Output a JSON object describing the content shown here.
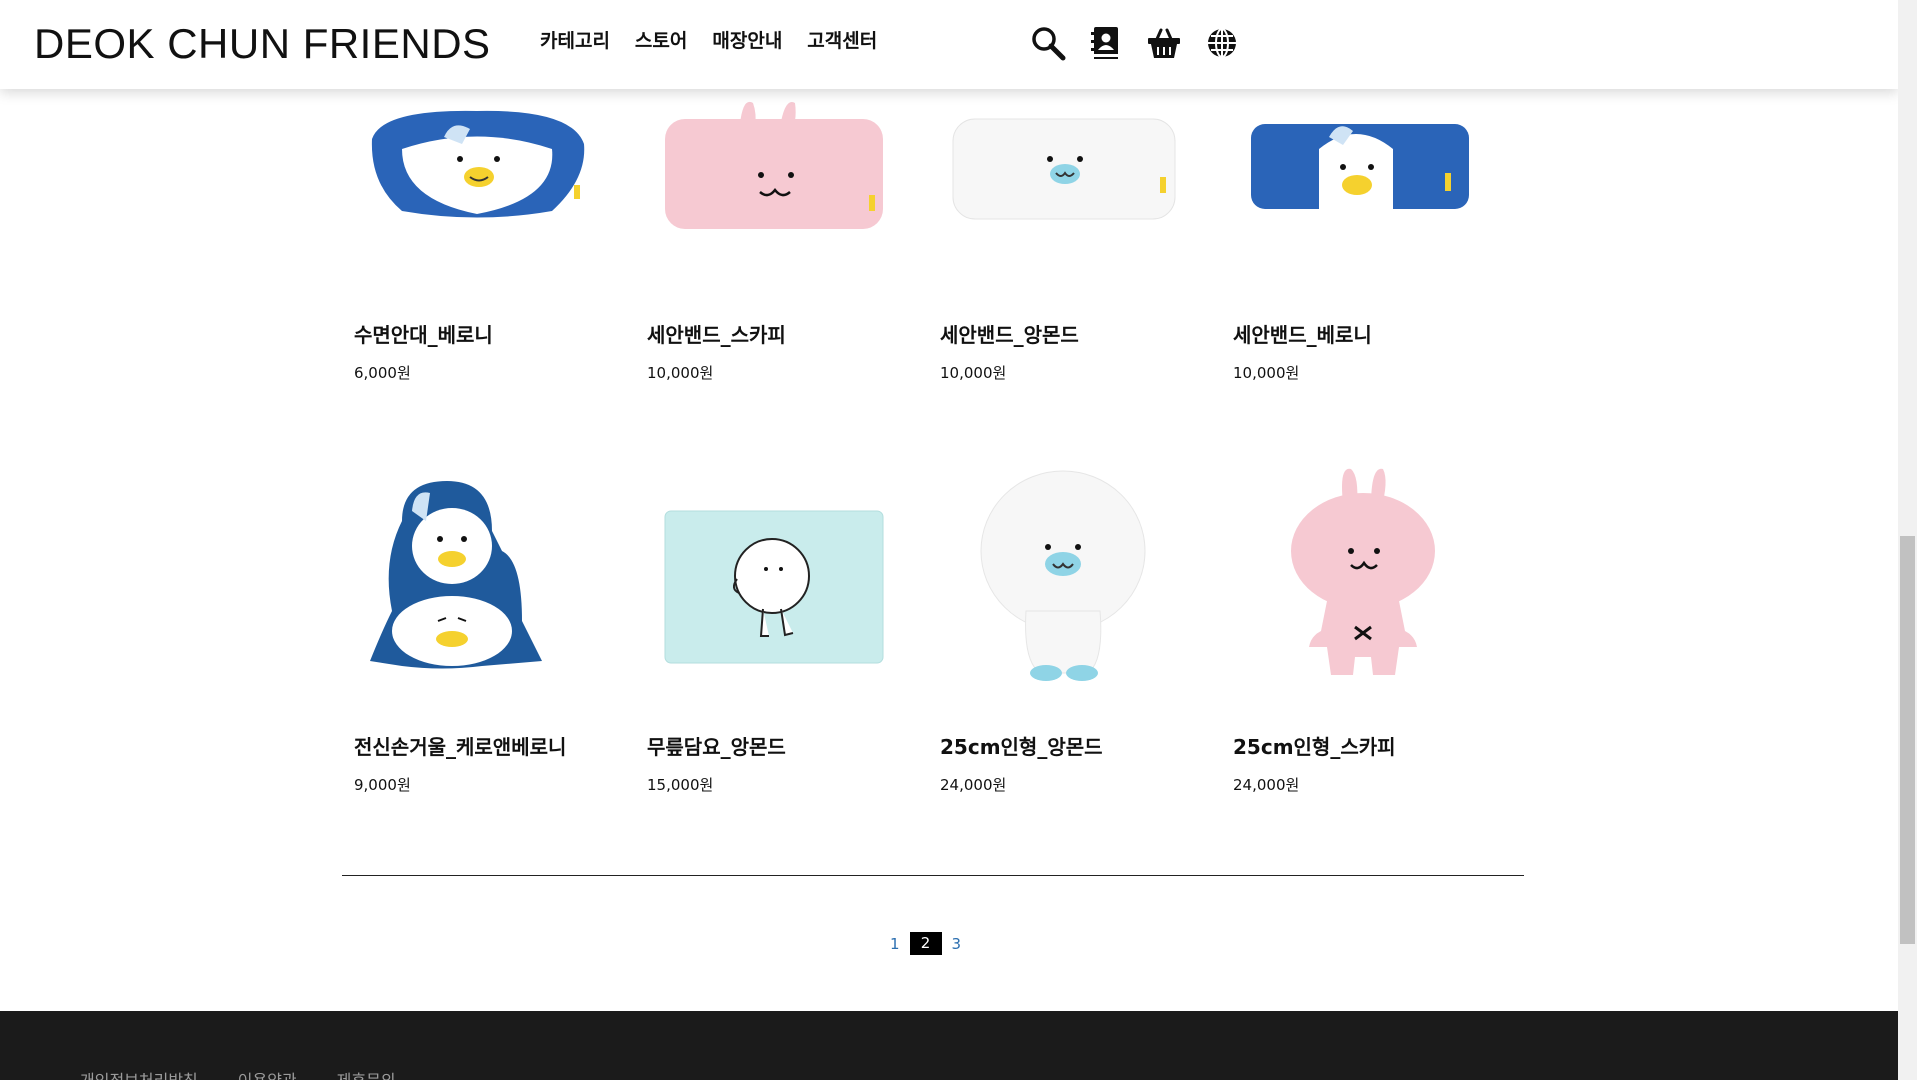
{
  "header": {
    "logo": "DEOK CHUN FRIENDS",
    "nav": [
      "카테고리",
      "스토어",
      "매장안내",
      "고객센터"
    ],
    "icons": [
      "search-icon",
      "contacts-icon",
      "basket-icon",
      "globe-icon"
    ]
  },
  "products": [
    {
      "name": "수면안대_베로니",
      "price": "6,000원"
    },
    {
      "name": "세안밴드_스카피",
      "price": "10,000원"
    },
    {
      "name": "세안밴드_앙몬드",
      "price": "10,000원"
    },
    {
      "name": "세안밴드_베로니",
      "price": "10,000원"
    },
    {
      "name": "전신손거울_케로앤베로니",
      "price": "9,000원"
    },
    {
      "name": "무릎담요_앙몬드",
      "price": "15,000원"
    },
    {
      "name": "25cm인형_앙몬드",
      "price": "24,000원"
    },
    {
      "name": "25cm인형_스카피",
      "price": "24,000원"
    }
  ],
  "pagination": {
    "pages": [
      "1",
      "2",
      "3"
    ],
    "current": "2"
  },
  "footer": {
    "links": [
      "개인정보처리방침",
      "이용약관",
      "제휴문의"
    ]
  },
  "colors": {
    "accent_blue": "#2c6fb0",
    "footer_bg": "#1b1b1b",
    "penguin_blue": "#2a64b8",
    "bunny_pink": "#f6c9d2",
    "blanket_mint": "#c9ecec"
  }
}
